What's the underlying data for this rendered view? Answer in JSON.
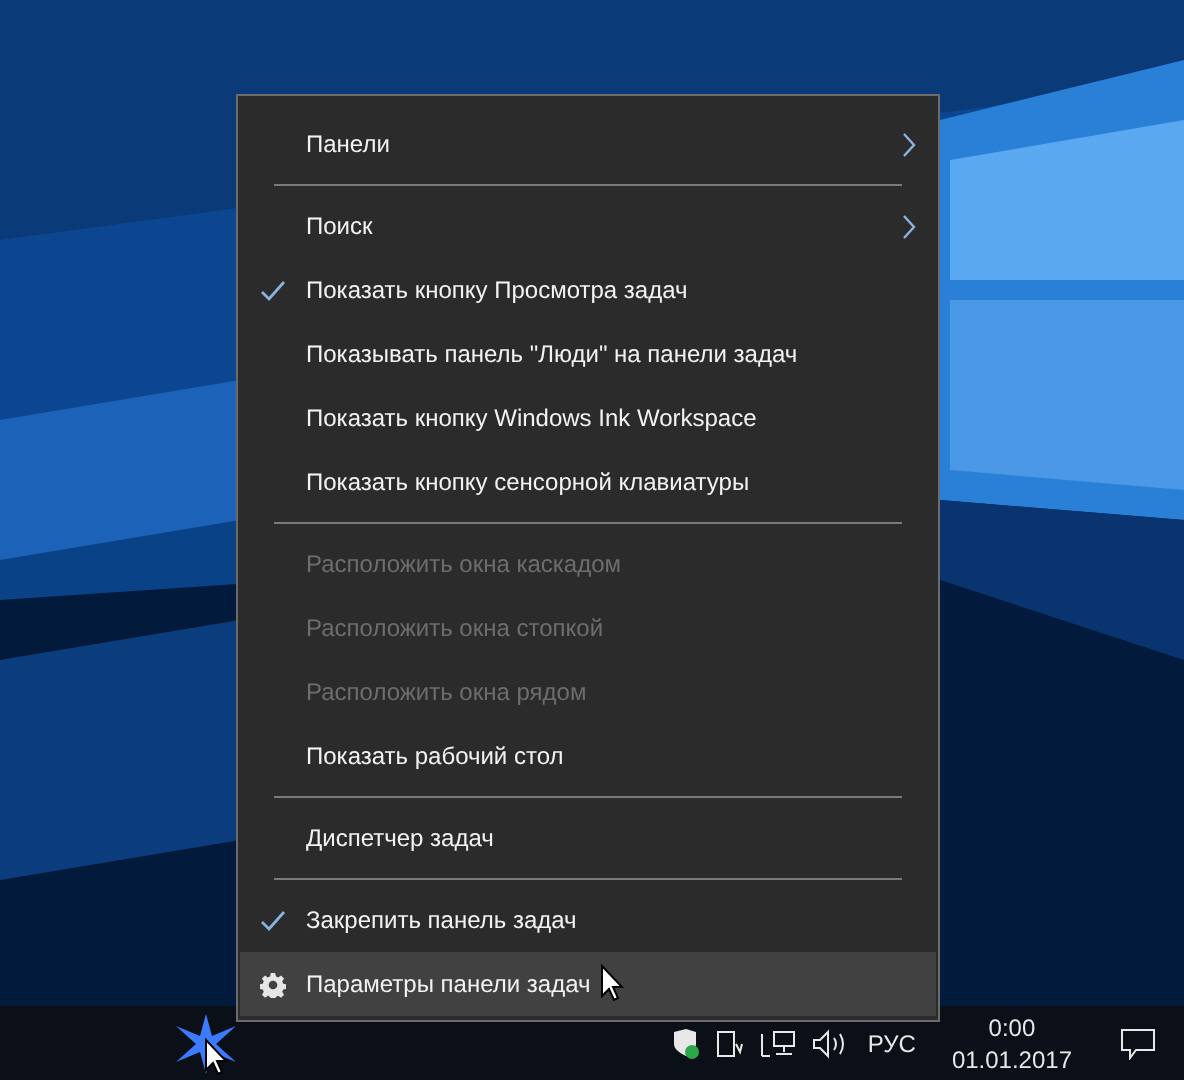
{
  "context_menu": {
    "items": [
      {
        "kind": "item",
        "label": "Панели",
        "checked": false,
        "disabled": false,
        "submenu": true,
        "highlighted": false
      },
      {
        "kind": "separator"
      },
      {
        "kind": "item",
        "label": "Поиск",
        "checked": false,
        "disabled": false,
        "submenu": true,
        "highlighted": false
      },
      {
        "kind": "item",
        "label": "Показать кнопку Просмотра задач",
        "checked": true,
        "disabled": false,
        "submenu": false,
        "highlighted": false
      },
      {
        "kind": "item",
        "label": "Показывать панель \"Люди\" на панели задач",
        "checked": false,
        "disabled": false,
        "submenu": false,
        "highlighted": false
      },
      {
        "kind": "item",
        "label": "Показать кнопку Windows Ink Workspace",
        "checked": false,
        "disabled": false,
        "submenu": false,
        "highlighted": false
      },
      {
        "kind": "item",
        "label": "Показать кнопку сенсорной клавиатуры",
        "checked": false,
        "disabled": false,
        "submenu": false,
        "highlighted": false
      },
      {
        "kind": "separator"
      },
      {
        "kind": "item",
        "label": "Расположить окна каскадом",
        "checked": false,
        "disabled": true,
        "submenu": false,
        "highlighted": false
      },
      {
        "kind": "item",
        "label": "Расположить окна стопкой",
        "checked": false,
        "disabled": true,
        "submenu": false,
        "highlighted": false
      },
      {
        "kind": "item",
        "label": "Расположить окна рядом",
        "checked": false,
        "disabled": true,
        "submenu": false,
        "highlighted": false
      },
      {
        "kind": "item",
        "label": "Показать рабочий стол",
        "checked": false,
        "disabled": false,
        "submenu": false,
        "highlighted": false
      },
      {
        "kind": "separator"
      },
      {
        "kind": "item",
        "label": "Диспетчер задач",
        "checked": false,
        "disabled": false,
        "submenu": false,
        "highlighted": false
      },
      {
        "kind": "separator"
      },
      {
        "kind": "item",
        "label": "Закрепить панель задач",
        "checked": true,
        "disabled": false,
        "submenu": false,
        "highlighted": false
      },
      {
        "kind": "settings_item",
        "label": "Параметры панели задач",
        "checked": false,
        "disabled": false,
        "submenu": false,
        "highlighted": true
      }
    ]
  },
  "taskbar": {
    "language": "РУС",
    "time": "0:00",
    "date": "01.01.2017"
  }
}
